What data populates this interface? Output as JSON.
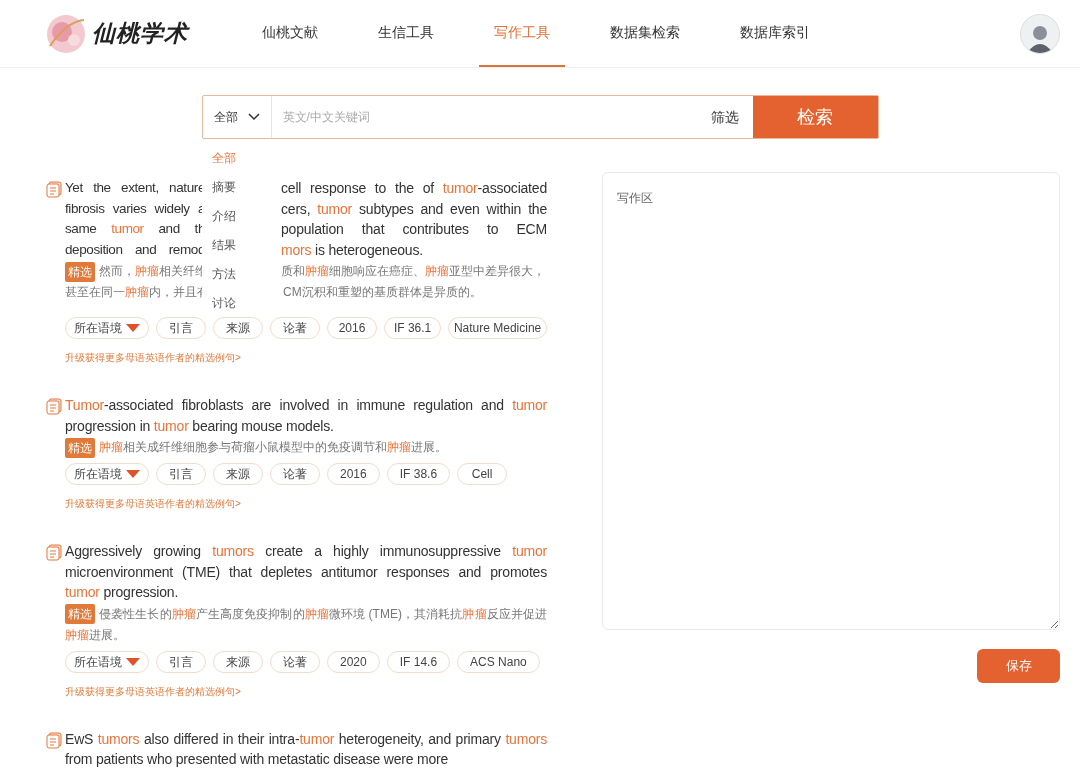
{
  "logo": {
    "text": "仙桃学术"
  },
  "nav": [
    {
      "label": "仙桃文献",
      "selected": false
    },
    {
      "label": "生信工具",
      "selected": false
    },
    {
      "label": "写作工具",
      "selected": true
    },
    {
      "label": "数据集检索",
      "selected": false
    },
    {
      "label": "数据库索引",
      "selected": false
    }
  ],
  "search": {
    "scope": "全部",
    "placeholder": "英文/中文关键词",
    "filter": "筛选",
    "button": "检索"
  },
  "scope_menu": [
    {
      "label": "全部",
      "selected": true
    },
    {
      "label": "摘要",
      "selected": false
    },
    {
      "label": "介绍",
      "selected": false
    },
    {
      "label": "结果",
      "selected": false
    },
    {
      "label": "方法",
      "selected": false
    },
    {
      "label": "讨论",
      "selected": false
    }
  ],
  "covered_entry": {
    "en_lines": [
      [
        [
          "Yet the extent, nature"
        ],
        [
          "cell response to the of ",
          {
            "highlight": "tumor"
          },
          "-associated"
        ]
      ],
      [
        [
          "fibrosis varies widely a"
        ],
        [
          "cers, ",
          {
            "highlight": "tumor"
          },
          " subtypes and even within the"
        ]
      ],
      [
        [
          "same ",
          {
            "highlight": "tumor"
          },
          " and th"
        ],
        [
          "population that contributes to ECM"
        ]
      ],
      [
        [
          "deposition and remod"
        ],
        [
          {
            "highlight": "mors"
          },
          " is heterogeneous."
        ]
      ]
    ],
    "badge": "精选",
    "zh_lines": [
      [
        [
          "然而，",
          {
            "highlight": "肿瘤"
          },
          "相关纤维"
        ],
        [
          "质和",
          {
            "highlight": "肿瘤"
          },
          "细胞响应在癌症、",
          {
            "highlight": "肿瘤"
          },
          "亚型中差异很大，"
        ]
      ],
      [
        [
          "甚至在同一",
          {
            "highlight": "肿瘤"
          },
          "内，并且有"
        ],
        [
          "CM沉积和重塑的基质群体是异质的。"
        ]
      ]
    ],
    "tags": [
      "所在语境",
      "引言",
      "来源",
      "论著",
      "2016",
      "IF 36.1",
      "Nature Medicine"
    ],
    "upgrade_link": "升级获得更多母语英语作者的精选例句>"
  },
  "entries": [
    {
      "en": [
        {
          "highlight": "Tumor"
        },
        "-associated fibroblasts are involved in immune regulation and ",
        {
          "highlight": "tumor"
        },
        " progression in ",
        {
          "highlight": "tumor"
        },
        " bearing mouse models."
      ],
      "badge": "精选",
      "zh": [
        {
          "highlight": "肿瘤"
        },
        "相关成纤维细胞参与荷瘤小鼠模型中的免疫调节和",
        {
          "highlight": "肿瘤"
        },
        "进展。"
      ],
      "tags": [
        "所在语境",
        "引言",
        "来源",
        "论著",
        "2016",
        "IF 38.6",
        "Cell"
      ],
      "upgrade_link": "升级获得更多母语英语作者的精选例句>"
    },
    {
      "en": [
        "Aggressively growing ",
        {
          "highlight": "tumors"
        },
        " create a highly immunosuppressive ",
        {
          "highlight": "tumor"
        },
        " microenvironment (TME) that depletes antitumor responses and promotes ",
        {
          "highlight": "tumor"
        },
        " progression."
      ],
      "badge": "精选",
      "zh": [
        "侵袭性生长的",
        {
          "highlight": "肿瘤"
        },
        "产生高度免疫抑制的",
        {
          "highlight": "肿瘤"
        },
        "微环境 (TME)，其消耗抗",
        {
          "highlight": "肿瘤"
        },
        "反应并促进",
        {
          "highlight": "肿瘤"
        },
        "进展。"
      ],
      "tags": [
        "所在语境",
        "引言",
        "来源",
        "论著",
        "2020",
        "IF 14.6",
        "ACS Nano"
      ],
      "upgrade_link": "升级获得更多母语英语作者的精选例句>"
    },
    {
      "en": [
        "EwS ",
        {
          "highlight": "tumors"
        },
        " also differed in their intra-",
        {
          "highlight": "tumor"
        },
        " heterogeneity, and primary ",
        {
          "highlight": "tumors"
        },
        " from patients who presented with metastatic disease were more"
      ]
    }
  ],
  "writing": {
    "placeholder": "写作区",
    "save": "保存"
  }
}
